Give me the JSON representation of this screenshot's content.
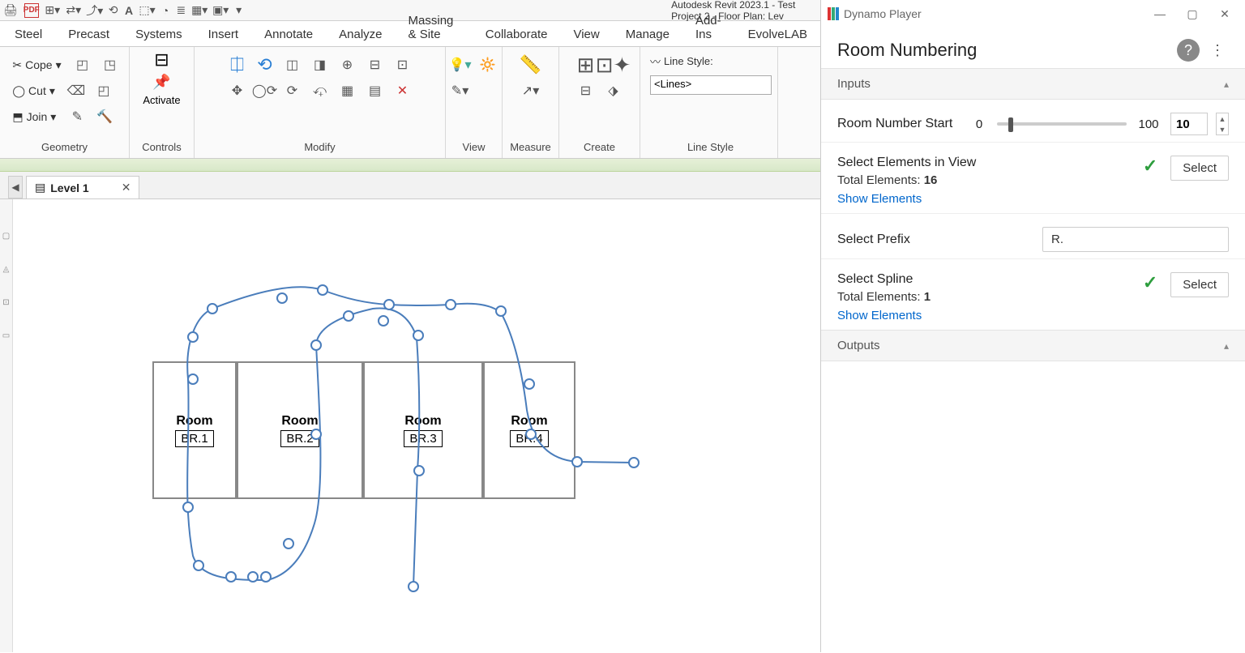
{
  "app": {
    "title": "Autodesk Revit 2023.1 - Test Project 2 - Floor Plan: Lev"
  },
  "menuTabs": [
    "Steel",
    "Precast",
    "Systems",
    "Insert",
    "Annotate",
    "Analyze",
    "Massing & Site",
    "Collaborate",
    "View",
    "Manage",
    "Add-Ins",
    "EvolveLAB"
  ],
  "ribbon": {
    "geometry": {
      "cope": "Cope",
      "cut": "Cut",
      "join": "Join",
      "title": "Geometry"
    },
    "controls": {
      "activate": "Activate",
      "title": "Controls"
    },
    "modify": {
      "title": "Modify"
    },
    "view": {
      "title": "View"
    },
    "measure": {
      "title": "Measure"
    },
    "create": {
      "title": "Create"
    },
    "lineStyle": {
      "label": "Line Style:",
      "value": "<Lines>",
      "title": "Line Style"
    }
  },
  "docTab": {
    "name": "Level 1"
  },
  "rooms": [
    {
      "label": "Room",
      "number": "BR.1"
    },
    {
      "label": "Room",
      "number": "BR.2"
    },
    {
      "label": "Room",
      "number": "BR.3"
    },
    {
      "label": "Room",
      "number": "BR.4"
    }
  ],
  "dynamo": {
    "windowTitle": "Dynamo Player",
    "scriptName": "Room Numbering",
    "inputsHeader": "Inputs",
    "outputsHeader": "Outputs",
    "roomNumberStart": {
      "label": "Room Number Start",
      "min": "0",
      "max": "100",
      "value": "10"
    },
    "selectElements": {
      "label": "Select Elements in View",
      "totalLabel": "Total Elements: ",
      "total": "16",
      "show": "Show Elements",
      "select": "Select"
    },
    "prefix": {
      "label": "Select Prefix",
      "value": "R."
    },
    "selectSpline": {
      "label": "Select Spline",
      "totalLabel": "Total Elements: ",
      "total": "1",
      "show": "Show Elements",
      "select": "Select"
    }
  }
}
